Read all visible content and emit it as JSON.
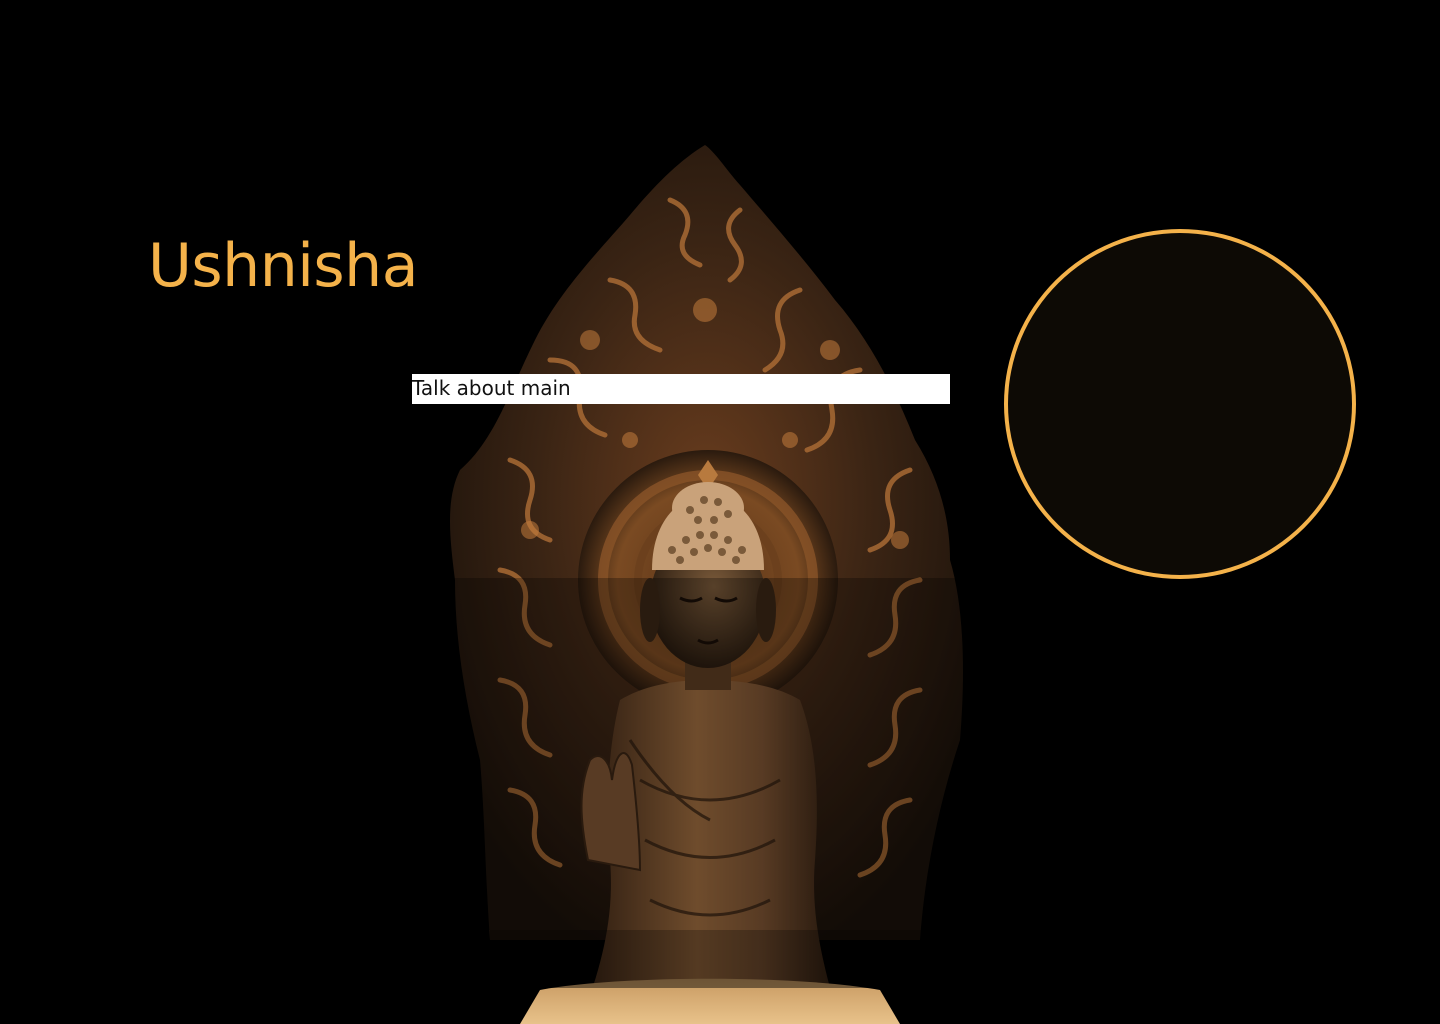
{
  "title": "Ushnisha",
  "caption": "Talk about main",
  "colors": {
    "background": "#000000",
    "accent": "#f4b24a",
    "circle_fill": "#0d0a05",
    "caption_bg": "#ffffff",
    "caption_text": "#111111"
  },
  "artwork": {
    "icon": "buddha-statue-image"
  }
}
